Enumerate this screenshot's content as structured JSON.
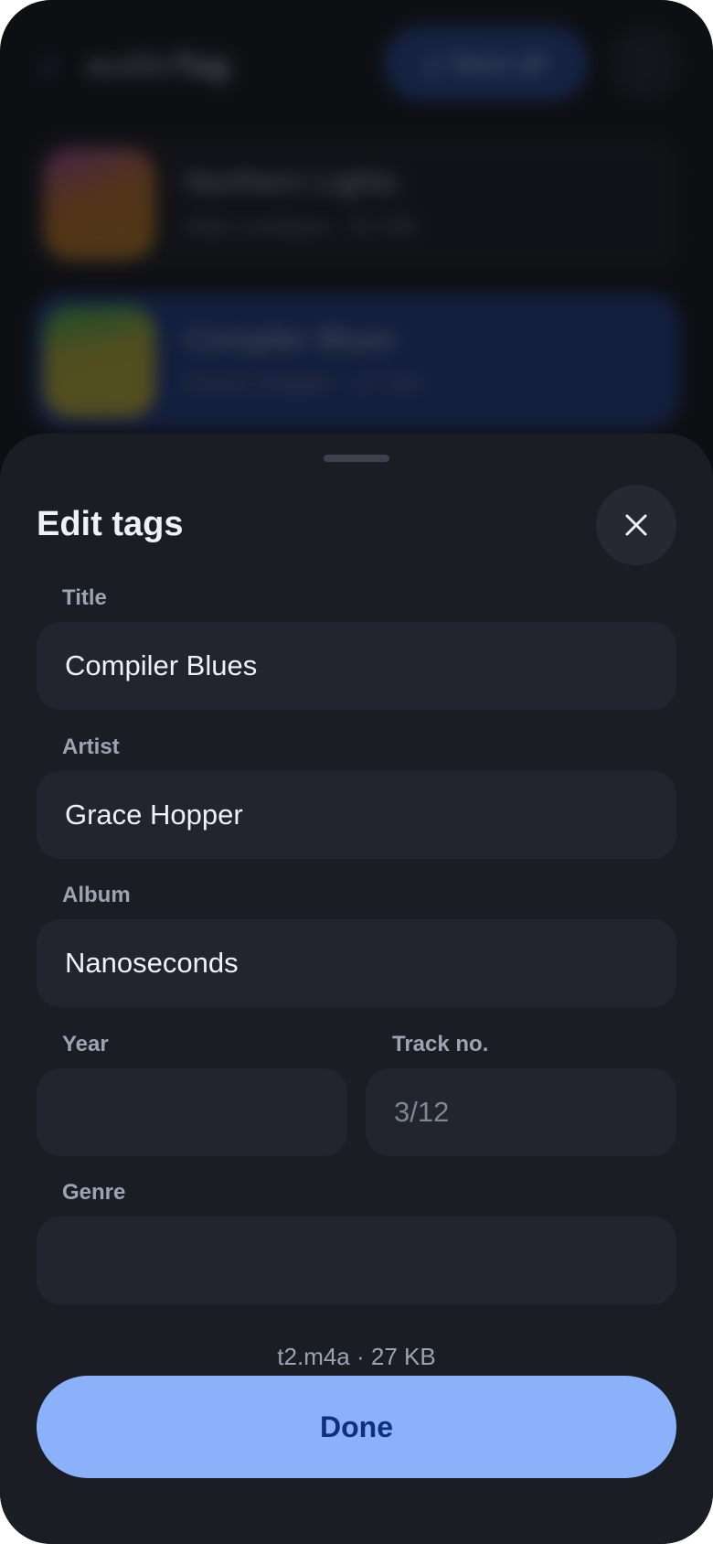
{
  "background_app": {
    "brand_prefix": "audio",
    "brand_suffix": "Tag",
    "save_label": "Save all",
    "more_icon": "more-vert-icon",
    "tracks": [
      {
        "title": "Northern Lights",
        "subtitle": "Ada Lovelace · 41 KB"
      },
      {
        "title": "Compiler Blues",
        "subtitle": "Grace Hopper · 27 KB"
      }
    ]
  },
  "sheet": {
    "title": "Edit tags",
    "close_icon": "close-icon",
    "fields": {
      "title": {
        "label": "Title",
        "value": "Compiler Blues",
        "placeholder": ""
      },
      "artist": {
        "label": "Artist",
        "value": "Grace Hopper",
        "placeholder": ""
      },
      "album": {
        "label": "Album",
        "value": "Nanoseconds",
        "placeholder": ""
      },
      "year": {
        "label": "Year",
        "value": "",
        "placeholder": ""
      },
      "track": {
        "label": "Track no.",
        "value": "",
        "placeholder": "3/12"
      },
      "genre": {
        "label": "Genre",
        "value": "",
        "placeholder": ""
      }
    },
    "file_info": "t2.m4a · 27 KB",
    "done_label": "Done"
  },
  "colors": {
    "accent": "#8cb1fb",
    "sheet_bg": "#1b1d24",
    "field_bg": "#22252d"
  }
}
